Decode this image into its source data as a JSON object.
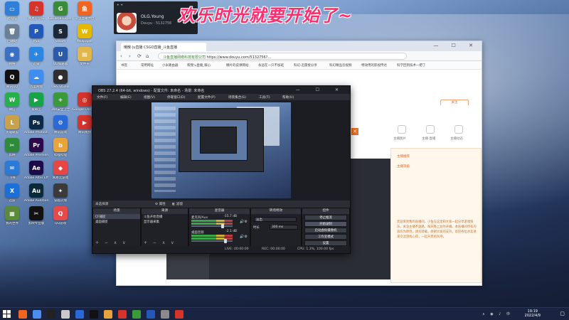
{
  "desktop": {
    "icons": [
      {
        "label": "此电脑",
        "glyph": "▭",
        "color": "#2f7fd8"
      },
      {
        "label": "网易云音乐",
        "glyph": "♫",
        "color": "#d6332a"
      },
      {
        "label": "GeForce Experience",
        "glyph": "G",
        "color": "#3a8a3a"
      },
      {
        "label": "斗鱼直播伴侣",
        "glyph": "鱼",
        "color": "#f06522"
      },
      {
        "label": "回收站",
        "glyph": "🗑",
        "color": "#6b7f96"
      },
      {
        "label": "PS4",
        "glyph": "P",
        "color": "#2458b8"
      },
      {
        "label": "Steam",
        "glyph": "S",
        "color": "#1b2838"
      },
      {
        "label": "Wallpaper",
        "glyph": "W",
        "color": "#e6b800"
      },
      {
        "label": "网络",
        "glyph": "◉",
        "color": "#3a6fc4"
      },
      {
        "label": "迅雷",
        "glyph": "✈",
        "color": "#2a86e0"
      },
      {
        "label": "UU加速器",
        "glyph": "U",
        "color": "#2a5aa8"
      },
      {
        "label": "文件夹",
        "glyph": "▤",
        "color": "#e2b64a"
      },
      {
        "label": "腾讯QQ",
        "glyph": "Q",
        "color": "#111"
      },
      {
        "label": "百度网盘",
        "glyph": "☁",
        "color": "#3d8ef0"
      },
      {
        "label": "OBS Studio",
        "glyph": "●",
        "color": "#302e31"
      },
      {
        "label": "",
        "glyph": "",
        "color": "rgba(0,0,0,0)"
      },
      {
        "label": "微信",
        "glyph": "W",
        "color": "#27b04a"
      },
      {
        "label": "爱奇艺",
        "glyph": "▶",
        "color": "#16a34a"
      },
      {
        "label": "360安全卫士",
        "glyph": "+",
        "color": "#3a9a3a"
      },
      {
        "label": "Google Chrome",
        "glyph": "◎",
        "color": "#d6332a"
      },
      {
        "label": "英雄联盟",
        "glyph": "L",
        "color": "#c8a24a"
      },
      {
        "label": "Adobe Photoshop",
        "glyph": "Ps",
        "color": "#0b2a4a"
      },
      {
        "label": "腾讯游戏",
        "glyph": "⚙",
        "color": "#2a6ad8"
      },
      {
        "label": "腾讯视频",
        "glyph": "▶",
        "color": "#d8342e"
      },
      {
        "label": "剪映",
        "glyph": "✂",
        "color": "#2f8b3a"
      },
      {
        "label": "Adobe Premiere",
        "glyph": "Pr",
        "color": "#2a0a4a"
      },
      {
        "label": "哔哩哔哩",
        "glyph": "b",
        "color": "#e8a33a"
      },
      {
        "label": "",
        "glyph": "",
        "color": "rgba(0,0,0,0)"
      },
      {
        "label": "飞书",
        "glyph": "✉",
        "color": "#2a7ad8"
      },
      {
        "label": "Adobe After Effects",
        "glyph": "Ae",
        "color": "#1a0a4a"
      },
      {
        "label": "网易云游戏",
        "glyph": "◆",
        "color": "#e84545"
      },
      {
        "label": "",
        "glyph": "",
        "color": "rgba(0,0,0,0)"
      },
      {
        "label": "迅游",
        "glyph": "X",
        "color": "#1b6fd8"
      },
      {
        "label": "Adobe Audition",
        "glyph": "Au",
        "color": "#0a2a3a"
      },
      {
        "label": "穿越火线",
        "glyph": "✦",
        "color": "#3a3a3a"
      },
      {
        "label": "",
        "glyph": "",
        "color": "rgba(0,0,0,0)"
      },
      {
        "label": "我的世界",
        "glyph": "▦",
        "color": "#5a8a3a"
      },
      {
        "label": "剪映专业版",
        "glyph": "✂",
        "color": "#111"
      },
      {
        "label": "QQ游戏",
        "glyph": "Q",
        "color": "#e84a4a"
      }
    ]
  },
  "streamer": {
    "name": "OLG.Young",
    "platform_id": "Douyu · 5132756",
    "menu_dots": "• •"
  },
  "overlay": {
    "slogan": "欢乐时光就要开始了~"
  },
  "browser": {
    "tab_title": "懒散·|u直播 CSGO直播_斗鱼直播",
    "url_prefix": "斗鱼直播网络科技有限公司 ",
    "url": "https://www.douyu.com/5132756?...",
    "nav": {
      "back": "‹",
      "forward": "›",
      "reload": "⟳",
      "home": "⌂"
    },
    "window_controls": "— ☐ ✕",
    "bookmarks": [
      "书签",
      "常用网址",
      "小米路由器",
      "帮我'u直播_暖心",
      "懒片的说课网站",
      "永远在一只不加班",
      "科幻·迅雷接分享",
      "科幻精品云视频",
      "特效用的影视传达",
      "科学回到技术一把了"
    ],
    "follow_label": "关注",
    "side_icons": [
      {
        "label": "主播图片"
      },
      {
        "label": "主播·直播"
      },
      {
        "label": "主播动态"
      }
    ],
    "panel_links": [
      "主播推荐",
      "主播等级"
    ],
    "announcement": "欢迎来到我的直播间，小鱼在这里和大家一起分享游戏快乐，关注主播不迷路，每天晚上准时开播。本直播间所有内容均为原创，请勿转载。感谢大家的支持，欢迎各位水友进来交流游戏心得，一起开黑组队吧。",
    "close_btn": "✕"
  },
  "obs": {
    "title": "OBS 27.2.4 (64-bit, windows) - 配置文件: 未命名 - 场景: 未命名",
    "window_controls": "— ☐ ✕",
    "menus": [
      "文件(F)",
      "编辑(E)",
      "视图(V)",
      "停靠窗口(D)",
      "配置文件(P)",
      "场景集合(S)",
      "工具(T)",
      "帮助(H)"
    ],
    "scene_strip_labels": {
      "left": "未选择源",
      "props": "⚙ 属性",
      "filters": "◧ 滤镜"
    },
    "docks": {
      "scenes": {
        "header": "场景",
        "items": [
          "CF捕捉",
          "桌面捕捉"
        ]
      },
      "sources": {
        "header": "来源",
        "items": [
          "斗鱼开始直播",
          "显示器采集"
        ]
      },
      "mixer": {
        "header": "混音器",
        "channels": [
          {
            "name": "麦克风/Aux",
            "db": "-15.7 dB",
            "level": 0.78
          },
          {
            "name": "桌面音频",
            "db": "-2.1 dB",
            "level": 0.86
          }
        ]
      },
      "transitions": {
        "header": "转场特效",
        "type_label": "淡出",
        "duration_label": "时长",
        "duration_value": "300 ms"
      },
      "controls": {
        "header": "控件",
        "buttons": [
          "停止推流",
          "开始录制",
          "启动虚拟摄像机",
          "工作室模式",
          "设置",
          "退出"
        ]
      }
    },
    "status": {
      "live": "LIVE: 00:00:00",
      "rec": "REC: 00:00:00",
      "cpu": "CPU: 1.3%, 100.00 fps"
    },
    "dock_footer_icons": "+ − ∧ ∨"
  },
  "taskbar": {
    "time": "19:19",
    "date": "2022/4/9",
    "tray": "∧ ◉ ♪ 中",
    "notify": "▢",
    "apps": [
      "#f06522",
      "#4a8ef0",
      "#222",
      "#c9c9c9",
      "#2a6ad8",
      "#111",
      "#e8a33a",
      "#d6332a",
      "#3a9a3a",
      "#2458b8",
      "#8a8a8a",
      "#d6332a"
    ]
  }
}
